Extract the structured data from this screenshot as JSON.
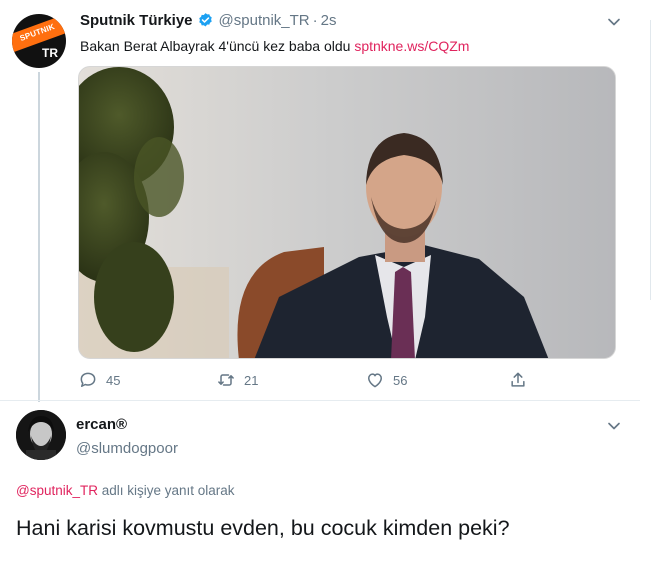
{
  "tweet": {
    "author_name": "Sputnik Türkiye",
    "author_handle": "@sputnik_TR",
    "separator": "·",
    "time": "2s",
    "avatar_text": "SPUTNIK",
    "avatar_sub": "TR",
    "text": "Bakan Berat Albayrak 4'üncü kez baba oldu ",
    "link": "sptnkne.ws/CQZm",
    "stats": {
      "replies": "45",
      "retweets": "21",
      "likes": "56"
    }
  },
  "reply": {
    "author_name": "ercan®",
    "author_handle": "@slumdogpoor",
    "context_mention": "@sputnik_TR",
    "context_suffix": " adlı kişiye yanıt olarak",
    "text": "Hani karisi kovmustu evden, bu cocuk kimden peki?"
  },
  "colors": {
    "accent": "#e0245e",
    "verified": "#1da1f2",
    "muted": "#657786",
    "text": "#14171a"
  },
  "icons": [
    "verified-badge-icon",
    "chevron-down-icon",
    "reply-icon",
    "retweet-icon",
    "like-icon",
    "share-icon"
  ]
}
